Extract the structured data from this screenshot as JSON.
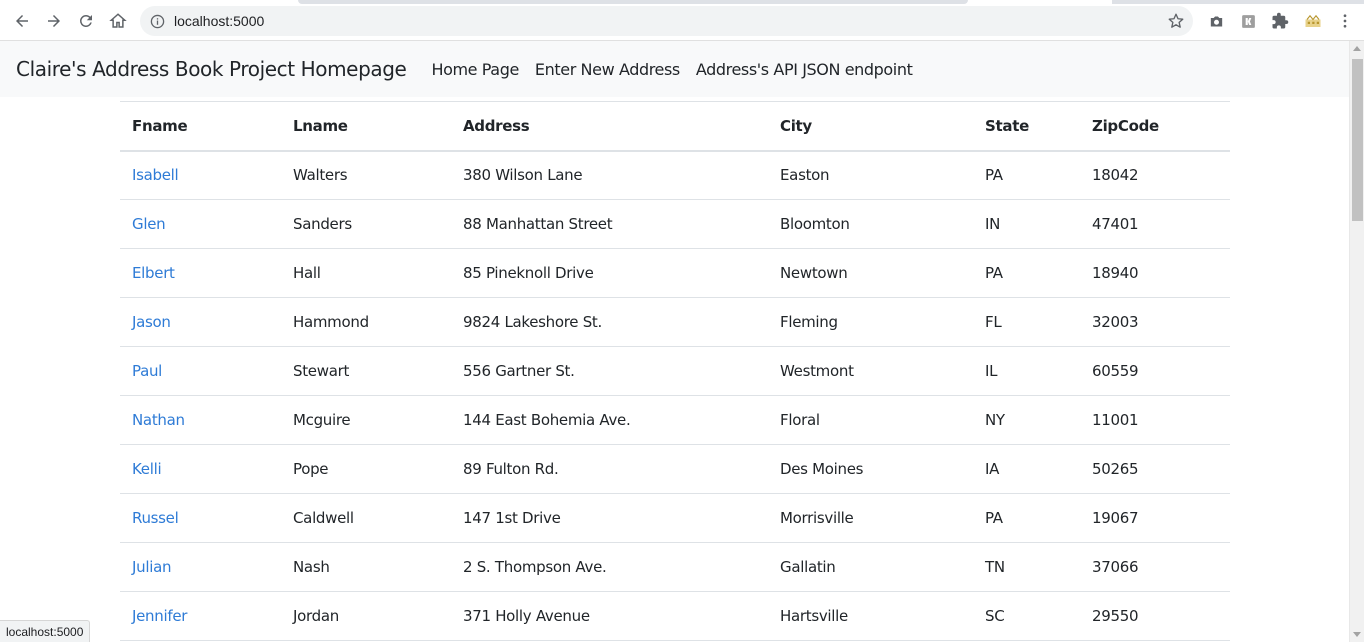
{
  "browser": {
    "url": "localhost:5000",
    "status_url": "localhost:5000"
  },
  "navbar": {
    "brand": "Claire's Address Book Project Homepage",
    "links": [
      "Home Page",
      "Enter New Address",
      "Address's API JSON endpoint"
    ]
  },
  "table": {
    "headers": [
      "Fname",
      "Lname",
      "Address",
      "City",
      "State",
      "ZipCode"
    ],
    "rows": [
      [
        "Isabell",
        "Walters",
        "380 Wilson Lane",
        "Easton",
        "PA",
        "18042"
      ],
      [
        "Glen",
        "Sanders",
        "88 Manhattan Street",
        "Bloomton",
        "IN",
        "47401"
      ],
      [
        "Elbert",
        "Hall",
        "85 Pineknoll Drive",
        "Newtown",
        "PA",
        "18940"
      ],
      [
        "Jason",
        "Hammond",
        "9824 Lakeshore St.",
        "Fleming",
        "FL",
        "32003"
      ],
      [
        "Paul",
        "Stewart",
        "556 Gartner St.",
        "Westmont",
        "IL",
        "60559"
      ],
      [
        "Nathan",
        "Mcguire",
        "144 East Bohemia Ave.",
        "Floral",
        "NY",
        "11001"
      ],
      [
        "Kelli",
        "Pope",
        "89 Fulton Rd.",
        "Des Moines",
        "IA",
        "50265"
      ],
      [
        "Russel",
        "Caldwell",
        "147 1st Drive",
        "Morrisville",
        "PA",
        "19067"
      ],
      [
        "Julian",
        "Nash",
        "2 S. Thompson Ave.",
        "Gallatin",
        "TN",
        "37066"
      ],
      [
        "Jennifer",
        "Jordan",
        "371 Holly Avenue",
        "Hartsville",
        "SC",
        "29550"
      ]
    ]
  },
  "colors": {
    "link": "#2e7bd6",
    "navbar_bg": "#f8f9fa",
    "text": "#212529"
  },
  "icons": [
    "back-icon",
    "forward-icon",
    "reload-icon",
    "home-icon",
    "info-icon",
    "star-icon",
    "camera-icon",
    "extension-icon",
    "puzzle-icon",
    "profile-icon",
    "menu-icon"
  ]
}
